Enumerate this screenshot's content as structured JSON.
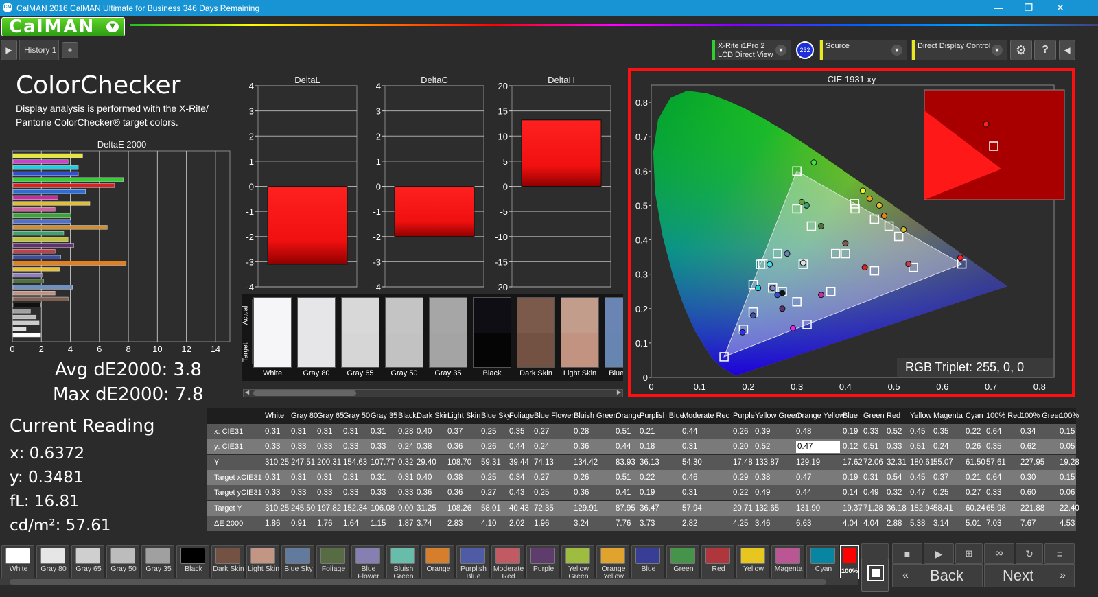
{
  "titlebar": {
    "title": "CalMAN 2016 CalMAN Ultimate for Business 346 Days Remaining",
    "icon": "CM",
    "minimize": "—",
    "restore": "❐",
    "close": "✕"
  },
  "brand": {
    "logo": "CalMAN",
    "dropdown_icon": "chevron-down-icon"
  },
  "tabs": {
    "history": "History 1",
    "add": "+"
  },
  "devices": {
    "meter": {
      "line1": "X-Rite i1Pro 2",
      "line2": "LCD Direct View",
      "color": "#2fcf2f"
    },
    "badge": "232",
    "source": {
      "label": "Source",
      "color": "#e8e820"
    },
    "display": {
      "label": "Direct Display Control",
      "color": "#e8e820"
    }
  },
  "colorchecker": {
    "title": "ColorChecker",
    "description": "Display analysis is performed with the X-Rite/ Pantone ColorChecker® target colors."
  },
  "de2000_chart": {
    "title": "DeltaE 2000",
    "ticks": [
      "0",
      "2",
      "4",
      "6",
      "8",
      "10",
      "12",
      "14"
    ],
    "bars": [
      {
        "color": "#e8e830",
        "value": 4.8
      },
      {
        "color": "#d040d0",
        "value": 3.8
      },
      {
        "color": "#20d0e0",
        "value": 4.5
      },
      {
        "color": "#3050d0",
        "value": 4.5
      },
      {
        "color": "#30d030",
        "value": 7.6
      },
      {
        "color": "#e02020",
        "value": 7.0
      },
      {
        "color": "#2f6ed0",
        "value": 5.0
      },
      {
        "color": "#c030a0",
        "value": 3.1
      },
      {
        "color": "#e0c030",
        "value": 5.3
      },
      {
        "color": "#d060a0",
        "value": 2.9
      },
      {
        "color": "#40a040",
        "value": 4.0
      },
      {
        "color": "#5070d0",
        "value": 4.0
      },
      {
        "color": "#d09030",
        "value": 6.5
      },
      {
        "color": "#40a070",
        "value": 3.5
      },
      {
        "color": "#c0c040",
        "value": 3.8
      },
      {
        "color": "#603070",
        "value": 4.2
      },
      {
        "color": "#c04050",
        "value": 2.9
      },
      {
        "color": "#4050a0",
        "value": 3.3
      },
      {
        "color": "#e08020",
        "value": 7.8
      },
      {
        "color": "#e8c030",
        "value": 3.2
      },
      {
        "color": "#9080c0",
        "value": 2.0
      },
      {
        "color": "#507040",
        "value": 2.1
      },
      {
        "color": "#7090c0",
        "value": 4.1
      },
      {
        "color": "#c09080",
        "value": 2.9
      },
      {
        "color": "#806050",
        "value": 3.8
      },
      {
        "color": "#111111",
        "value": 1.9
      },
      {
        "color": "#a0a0a0",
        "value": 1.2
      },
      {
        "color": "#bbbbbb",
        "value": 1.6
      },
      {
        "color": "#cccccc",
        "value": 1.8
      },
      {
        "color": "#dddddd",
        "value": 0.9
      },
      {
        "color": "#ffffff",
        "value": 1.9
      }
    ]
  },
  "averages": {
    "avg": "Avg dE2000: 3.8",
    "max": "Max dE2000: 7.8"
  },
  "delta_charts": [
    {
      "title": "DeltaL",
      "ticks": [
        "4",
        "3",
        "2",
        "1",
        "0",
        "-1",
        "-2",
        "-3",
        "-4"
      ],
      "min": -4,
      "max": 4,
      "value": -3.1
    },
    {
      "title": "DeltaC",
      "ticks": [
        "4",
        "3",
        "2",
        "1",
        "0",
        "-1",
        "-2",
        "-3",
        "-4"
      ],
      "min": -4,
      "max": 4,
      "value": -2.0
    },
    {
      "title": "DeltaH",
      "ticks": [
        "20",
        "15",
        "10",
        "5",
        "0",
        "-5",
        "-10",
        "-15",
        "-20"
      ],
      "min": -20,
      "max": 20,
      "value": 13.2
    }
  ],
  "swatch_axis": {
    "actual": "Actual",
    "target": "Target"
  },
  "swatches": [
    {
      "label": "White",
      "actual": "#f6f6f8",
      "target": "#f6f6f8"
    },
    {
      "label": "Gray 80",
      "actual": "#e6e6e8",
      "target": "#e6e6e8"
    },
    {
      "label": "Gray 65",
      "actual": "#d8d8d8",
      "target": "#d6d6d6"
    },
    {
      "label": "Gray 50",
      "actual": "#c4c4c4",
      "target": "#c2c2c2"
    },
    {
      "label": "Gray 35",
      "actual": "#a6a6a6",
      "target": "#a4a4a4"
    },
    {
      "label": "Black",
      "actual": "#0e0e14",
      "target": "#050505"
    },
    {
      "label": "Dark Skin",
      "actual": "#7b5a4c",
      "target": "#735243"
    },
    {
      "label": "Light Skin",
      "actual": "#c29d8c",
      "target": "#c29381"
    },
    {
      "label": "Blue Sky",
      "actual": "#6a85b4",
      "target": "#6685b0"
    }
  ],
  "cie": {
    "title": "CIE 1931 xy",
    "xticks": [
      "0",
      "0.1",
      "0.2",
      "0.3",
      "0.4",
      "0.5",
      "0.6",
      "0.7",
      "0.8"
    ],
    "yticks": [
      "0.8",
      "0.7",
      "0.6",
      "0.5",
      "0.4",
      "0.3",
      "0.2",
      "0.1",
      "0"
    ],
    "triplet": "RGB Triplet: 255, 0, 0",
    "gamut": [
      [
        0.64,
        0.33
      ],
      [
        0.3,
        0.6
      ],
      [
        0.15,
        0.06
      ]
    ],
    "targets": [
      [
        0.64,
        0.33
      ],
      [
        0.3,
        0.6
      ],
      [
        0.15,
        0.06
      ],
      [
        0.225,
        0.329
      ],
      [
        0.321,
        0.154
      ],
      [
        0.419,
        0.505
      ],
      [
        0.313,
        0.329
      ],
      [
        0.3,
        0.49
      ],
      [
        0.38,
        0.36
      ],
      [
        0.26,
        0.36
      ],
      [
        0.33,
        0.44
      ],
      [
        0.42,
        0.49
      ],
      [
        0.46,
        0.46
      ],
      [
        0.51,
        0.41
      ],
      [
        0.54,
        0.32
      ],
      [
        0.46,
        0.31
      ],
      [
        0.37,
        0.25
      ],
      [
        0.3,
        0.22
      ],
      [
        0.27,
        0.25
      ],
      [
        0.25,
        0.26
      ],
      [
        0.21,
        0.27
      ],
      [
        0.23,
        0.33
      ],
      [
        0.19,
        0.14
      ],
      [
        0.21,
        0.19
      ],
      [
        0.49,
        0.44
      ],
      [
        0.4,
        0.36
      ]
    ],
    "measured": [
      {
        "x": 0.637,
        "y": 0.348,
        "c": "#ff2020"
      },
      {
        "x": 0.335,
        "y": 0.625,
        "c": "#40e040"
      },
      {
        "x": 0.188,
        "y": 0.131,
        "c": "#3030f0"
      },
      {
        "x": 0.244,
        "y": 0.329,
        "c": "#40e0f0"
      },
      {
        "x": 0.292,
        "y": 0.143,
        "c": "#f020f0"
      },
      {
        "x": 0.436,
        "y": 0.543,
        "c": "#f0f020"
      },
      {
        "x": 0.313,
        "y": 0.333,
        "c": "#e0e0e0"
      },
      {
        "x": 0.31,
        "y": 0.51,
        "c": "#60a040"
      },
      {
        "x": 0.4,
        "y": 0.39,
        "c": "#7a5a4c"
      },
      {
        "x": 0.28,
        "y": 0.36,
        "c": "#6a85b4"
      },
      {
        "x": 0.35,
        "y": 0.44,
        "c": "#507040"
      },
      {
        "x": 0.45,
        "y": 0.52,
        "c": "#e8a020"
      },
      {
        "x": 0.48,
        "y": 0.47,
        "c": "#e08020"
      },
      {
        "x": 0.52,
        "y": 0.43,
        "c": "#d0c030"
      },
      {
        "x": 0.53,
        "y": 0.33,
        "c": "#c04050"
      },
      {
        "x": 0.44,
        "y": 0.32,
        "c": "#e02020"
      },
      {
        "x": 0.35,
        "y": 0.24,
        "c": "#c030a0"
      },
      {
        "x": 0.26,
        "y": 0.24,
        "c": "#3050d0"
      },
      {
        "x": 0.25,
        "y": 0.26,
        "c": "#9080c0"
      },
      {
        "x": 0.22,
        "y": 0.26,
        "c": "#20d0e0"
      },
      {
        "x": 0.21,
        "y": 0.18,
        "c": "#4050a0"
      },
      {
        "x": 0.27,
        "y": 0.2,
        "c": "#603070"
      },
      {
        "x": 0.27,
        "y": 0.245,
        "c": "#111111"
      },
      {
        "x": 0.32,
        "y": 0.5,
        "c": "#40a070"
      },
      {
        "x": 0.47,
        "y": 0.5,
        "c": "#e8c030"
      }
    ]
  },
  "table": {
    "headers": [
      "White",
      "Gray 80",
      "Gray 65",
      "Gray 50",
      "Gray 35",
      "Black",
      "Dark Skin",
      "Light Skin",
      "Blue Sky",
      "Foliage",
      "Blue Flower",
      "Bluish Green",
      "Orange",
      "Purplish Blue",
      "Moderate Red",
      "Purple",
      "Yellow Green",
      "Orange Yellow",
      "Blue",
      "Green",
      "Red",
      "Yellow",
      "Magenta",
      "Cyan",
      "100% Red",
      "100% Green",
      "100%"
    ],
    "rows": [
      {
        "label": "x: CIE31",
        "values": [
          "0.31",
          "0.31",
          "0.31",
          "0.31",
          "0.31",
          "0.28",
          "0.40",
          "0.37",
          "0.25",
          "0.35",
          "0.27",
          "0.28",
          "0.51",
          "0.21",
          "0.44",
          "0.26",
          "0.39",
          "0.48",
          "0.19",
          "0.33",
          "0.52",
          "0.45",
          "0.35",
          "0.22",
          "0.64",
          "0.34",
          "0.15"
        ]
      },
      {
        "label": "y: CIE31",
        "values": [
          "0.33",
          "0.33",
          "0.33",
          "0.33",
          "0.33",
          "0.24",
          "0.38",
          "0.36",
          "0.26",
          "0.44",
          "0.24",
          "0.36",
          "0.44",
          "0.18",
          "0.31",
          "0.20",
          "0.52",
          "0.47",
          "0.12",
          "0.51",
          "0.33",
          "0.51",
          "0.24",
          "0.26",
          "0.35",
          "0.62",
          "0.05"
        ]
      },
      {
        "label": "Y",
        "values": [
          "310.25",
          "247.51",
          "200.31",
          "154.63",
          "107.77",
          "0.32",
          "29.40",
          "108.70",
          "59.31",
          "39.44",
          "74.13",
          "134.42",
          "83.93",
          "36.13",
          "54.30",
          "17.48",
          "133.87",
          "129.19",
          "17.62",
          "72.06",
          "32.31",
          "180.61",
          "55.07",
          "61.50",
          "57.61",
          "227.95",
          "19.28"
        ]
      },
      {
        "label": "Target xCIE31",
        "values": [
          "0.31",
          "0.31",
          "0.31",
          "0.31",
          "0.31",
          "0.31",
          "0.40",
          "0.38",
          "0.25",
          "0.34",
          "0.27",
          "0.26",
          "0.51",
          "0.22",
          "0.46",
          "0.29",
          "0.38",
          "0.47",
          "0.19",
          "0.31",
          "0.54",
          "0.45",
          "0.37",
          "0.21",
          "0.64",
          "0.30",
          "0.15"
        ]
      },
      {
        "label": "Target yCIE31",
        "values": [
          "0.33",
          "0.33",
          "0.33",
          "0.33",
          "0.33",
          "0.33",
          "0.36",
          "0.36",
          "0.27",
          "0.43",
          "0.25",
          "0.36",
          "0.41",
          "0.19",
          "0.31",
          "0.22",
          "0.49",
          "0.44",
          "0.14",
          "0.49",
          "0.32",
          "0.47",
          "0.25",
          "0.27",
          "0.33",
          "0.60",
          "0.06"
        ]
      },
      {
        "label": "Target Y",
        "values": [
          "310.25",
          "245.50",
          "197.82",
          "152.34",
          "106.08",
          "0.00",
          "31.25",
          "108.26",
          "58.01",
          "40.43",
          "72.35",
          "129.91",
          "87.95",
          "36.47",
          "57.94",
          "20.71",
          "132.65",
          "131.90",
          "19.37",
          "71.28",
          "36.18",
          "182.94",
          "58.41",
          "60.24",
          "65.98",
          "221.88",
          "22.40"
        ]
      },
      {
        "label": "ΔE 2000",
        "values": [
          "1.86",
          "0.91",
          "1.76",
          "1.64",
          "1.15",
          "1.87",
          "3.74",
          "2.83",
          "4.10",
          "2.02",
          "1.96",
          "3.24",
          "7.76",
          "3.73",
          "2.82",
          "4.25",
          "3.46",
          "6.63",
          "4.04",
          "4.04",
          "2.88",
          "5.38",
          "3.14",
          "5.01",
          "7.03",
          "7.67",
          "4.53"
        ]
      }
    ]
  },
  "current_reading": {
    "title": "Current Reading",
    "x": "x: 0.6372",
    "y": "y: 0.3481",
    "fl": "fL: 16.81",
    "cdm2": "cd/m²: 57.61"
  },
  "bottom_swatches": [
    {
      "label": "White",
      "color": "#ffffff"
    },
    {
      "label": "Gray 80",
      "color": "#e6e6e6"
    },
    {
      "label": "Gray 65",
      "color": "#cfcfcf"
    },
    {
      "label": "Gray 50",
      "color": "#bcbcbc"
    },
    {
      "label": "Gray 35",
      "color": "#a0a0a0"
    },
    {
      "label": "Black",
      "color": "#000000"
    },
    {
      "label": "Dark Skin",
      "color": "#735243"
    },
    {
      "label": "Light Skin",
      "color": "#c29682"
    },
    {
      "label": "Blue Sky",
      "color": "#627a9d"
    },
    {
      "label": "Foliage",
      "color": "#576c43"
    },
    {
      "label": "Blue Flower",
      "color": "#8580b1"
    },
    {
      "label": "Bluish Green",
      "color": "#67bdaa"
    },
    {
      "label": "Orange",
      "color": "#d67e2c"
    },
    {
      "label": "Purplish Blue",
      "color": "#505ba6"
    },
    {
      "label": "Moderate Red",
      "color": "#c15a63"
    },
    {
      "label": "Purple",
      "color": "#5e3c6c"
    },
    {
      "label": "Yellow Green",
      "color": "#9dbc40"
    },
    {
      "label": "Orange Yellow",
      "color": "#e0a32e"
    },
    {
      "label": "Blue",
      "color": "#383d96"
    },
    {
      "label": "Green",
      "color": "#469449"
    },
    {
      "label": "Red",
      "color": "#af363c"
    },
    {
      "label": "Yellow",
      "color": "#e7c71f"
    },
    {
      "label": "Magenta",
      "color": "#bb5695"
    },
    {
      "label": "Cyan",
      "color": "#0885a1"
    }
  ],
  "current_patch": {
    "label": "100%",
    "color": "#ff0000"
  },
  "nav": {
    "back": "Back",
    "next": "Next"
  }
}
